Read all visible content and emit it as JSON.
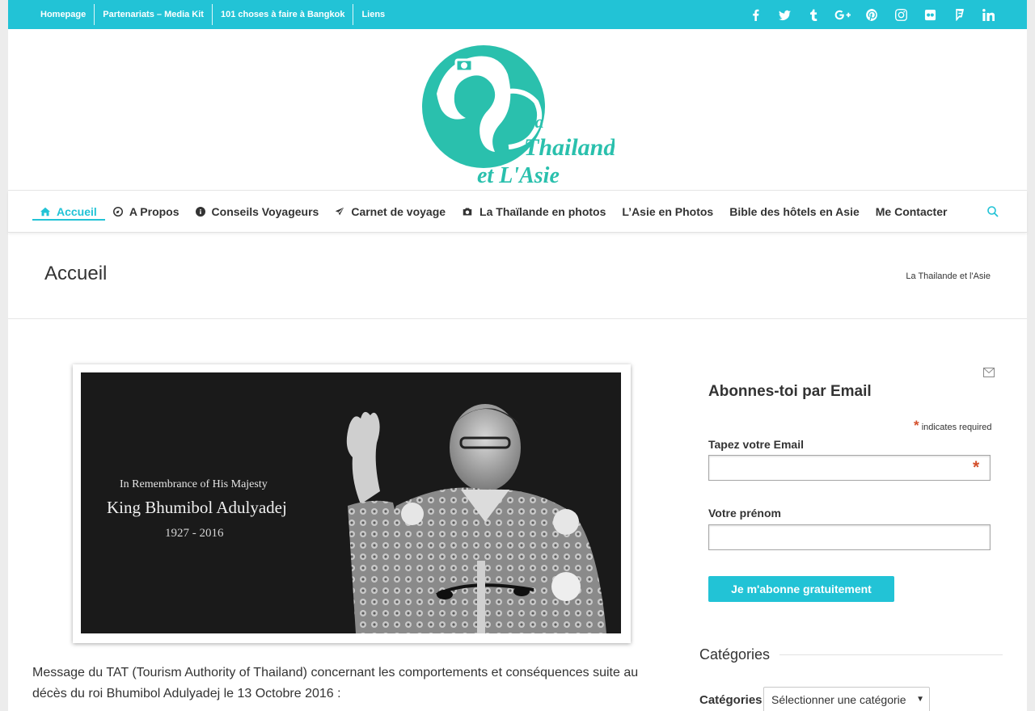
{
  "topbar": {
    "links": [
      "Homepage",
      "Partenariats – Media Kit",
      "101 choses à faire à Bangkok",
      "Liens"
    ],
    "social": [
      "facebook-icon",
      "twitter-icon",
      "tumblr-icon",
      "google-plus-icon",
      "pinterest-icon",
      "instagram-icon",
      "flickr-icon",
      "foursquare-icon",
      "linkedin-icon"
    ],
    "color": "#22c3d6"
  },
  "logo": {
    "line1": "La",
    "line2": "Thailande",
    "line3": "et L'Asie"
  },
  "nav": {
    "items": [
      {
        "label": "Accueil",
        "icon": "home-icon",
        "active": true
      },
      {
        "label": "A Propos",
        "icon": "compass-icon"
      },
      {
        "label": "Conseils Voyageurs",
        "icon": "info-circle-icon"
      },
      {
        "label": "Carnet de voyage",
        "icon": "plane-icon"
      },
      {
        "label": "La Thaïlande en photos",
        "icon": "camera-icon"
      },
      {
        "label": "L’Asie en Photos"
      },
      {
        "label": "Bible des hôtels en Asie"
      },
      {
        "label": "Me Contacter"
      }
    ],
    "search_icon": "search-icon"
  },
  "title_band": {
    "title": "Accueil",
    "breadcrumb": "La Thailande et l'Asie"
  },
  "featured": {
    "line1": "In Remembrance of His Majesty",
    "line2": "King Bhumibol Adulyadej",
    "line3": "1927 - 2016"
  },
  "article": {
    "text": "Message du TAT (Tourism Authority of Thailand) concernant les comportements et conséquences suite au décès du roi Bhumibol Adulyadej le 13 Octobre 2016 :"
  },
  "sidebar": {
    "mail_icon": "envelope-icon",
    "title": "Abonnes-toi par Email",
    "required_star": "*",
    "required_note": "indicates required",
    "email_label": "Tapez votre Email",
    "email_value": "",
    "email_star": "*",
    "first_label": "Votre prénom",
    "first_value": "",
    "button": "Je m'abonne gratuitement",
    "categories_heading": "Catégories",
    "categories_label": "Catégories",
    "categories_selected": "Sélectionner une catégorie"
  }
}
